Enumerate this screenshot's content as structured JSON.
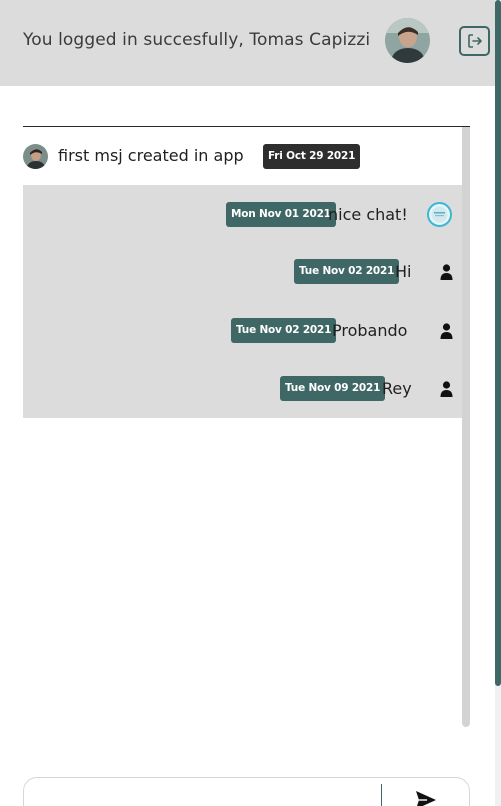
{
  "header": {
    "welcome_text": "You logged in succesfully, Tomas Capizzi",
    "avatar_icon": "user-photo-icon",
    "logout_icon": "logout-icon"
  },
  "chat": {
    "first_message": {
      "text": "first msj created in app",
      "date": "Fri Oct 29 2021"
    },
    "messages": [
      {
        "date": "Mon Nov 01 2021",
        "text": "nice chat!",
        "avatar": "bot-avatar-icon"
      },
      {
        "date": "Tue Nov 02 2021",
        "text": "Hi",
        "avatar": "user-icon"
      },
      {
        "date": "Tue Nov 02 2021",
        "text": "Probando",
        "avatar": "user-icon"
      },
      {
        "date": "Tue Nov 09 2021",
        "text": "Rey",
        "avatar": "user-icon"
      }
    ]
  },
  "composer": {
    "placeholder": "",
    "send_icon": "send-icon"
  },
  "colors": {
    "header_bg": "#dcdcdc",
    "accent": "#3f6766",
    "badge_dark": "#2e2e2e",
    "message_bg": "#dcdcdc"
  }
}
